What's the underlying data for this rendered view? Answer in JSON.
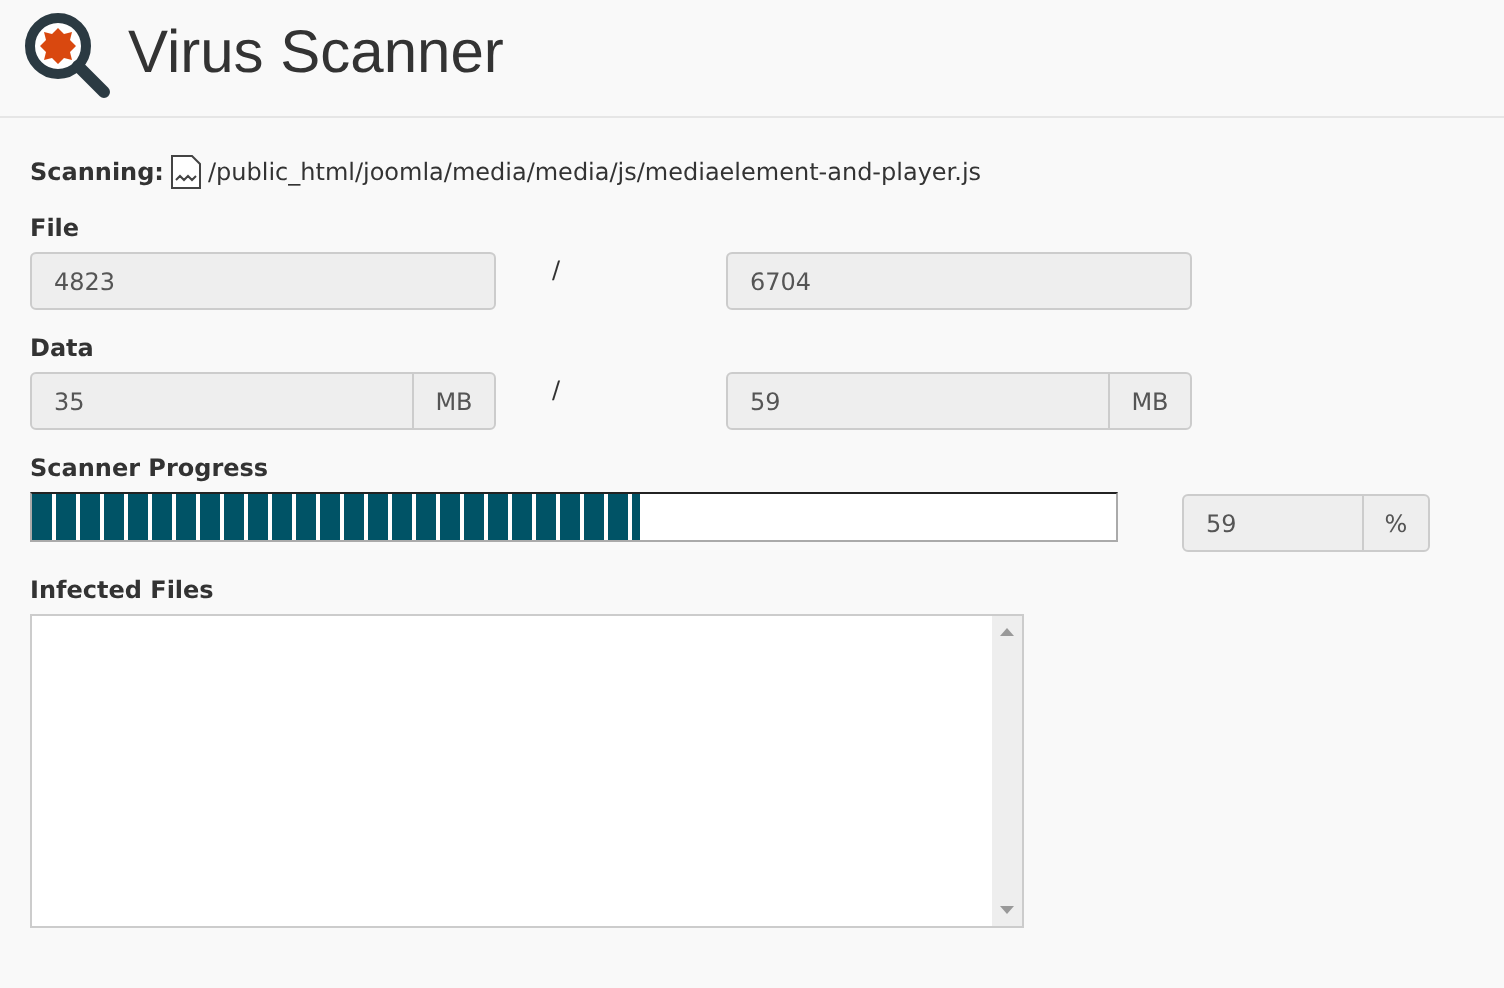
{
  "title": "Virus Scanner",
  "scanning": {
    "label": "Scanning:",
    "path": "/public_html/joomla/media/media/js/mediaelement-and-player.js"
  },
  "file": {
    "label": "File",
    "current": "4823",
    "separator": "/",
    "total": "6704"
  },
  "data": {
    "label": "Data",
    "current": "35",
    "current_unit": "MB",
    "separator": "/",
    "total": "59",
    "total_unit": "MB"
  },
  "progress": {
    "label": "Scanner Progress",
    "level": 0.56,
    "reading": "59",
    "unit": "%"
  },
  "infected": {
    "label": "Infected Files"
  }
}
